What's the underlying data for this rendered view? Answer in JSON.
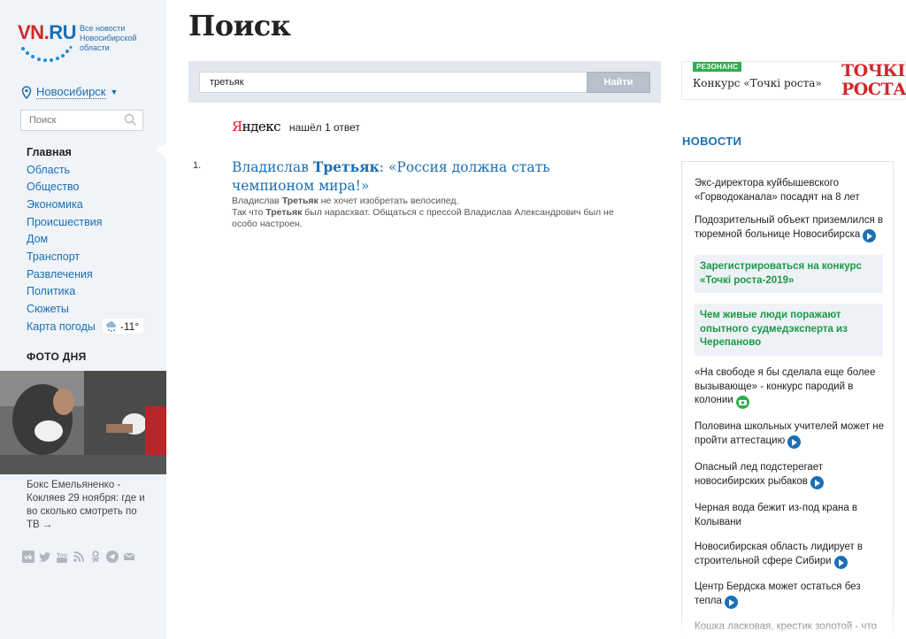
{
  "logo": {
    "brand_vn": "VN",
    "brand_dot": ".",
    "brand_ru": "RU",
    "tagline": "Все новости Новосибирской области"
  },
  "city": {
    "label": "Новосибирск"
  },
  "sidebar_search": {
    "placeholder": "Поиск"
  },
  "nav": {
    "items": [
      {
        "label": "Главная",
        "active": true
      },
      {
        "label": "Область"
      },
      {
        "label": "Общество"
      },
      {
        "label": "Экономика"
      },
      {
        "label": "Происшествия"
      },
      {
        "label": "Дом"
      },
      {
        "label": "Транспорт"
      },
      {
        "label": "Развлечения"
      },
      {
        "label": "Политика"
      },
      {
        "label": "Сюжеты"
      },
      {
        "label": "Карта погоды"
      }
    ],
    "weather_temp": "-11°"
  },
  "photo_of_day": {
    "title": "ФОТО ДНЯ",
    "caption": "Бокс Емельяненко - Кокляев 29 ноября: где и во сколько смотреть по ТВ",
    "caption_arrow": "→"
  },
  "socials": [
    "vk-icon",
    "twitter-icon",
    "youtube-icon",
    "rss-icon",
    "odnoklassniki-icon",
    "telegram-icon",
    "mail-icon"
  ],
  "page": {
    "title": "Поиск"
  },
  "search": {
    "value": "третьяк",
    "button_label": "Найти"
  },
  "results_header": {
    "yandex_y": "Я",
    "yandex_rest": "ндекс",
    "found_text": "нашёл 1 ответ"
  },
  "results": [
    {
      "num": "1.",
      "title_pre": "Владислав ",
      "title_hit": "Третьяк",
      "title_post": ": «Россия должна стать чемпионом мира!»",
      "snippet_1_pre": "Владислав ",
      "snippet_1_hit": "Третьяк",
      "snippet_1_post": " не хочет изобретать велосипед.",
      "snippet_2_pre": "Так что ",
      "snippet_2_hit": "Третьяк",
      "snippet_2_post": " был нарасхват. Общаться с прессой Владислав Александрович был не особо настроен."
    }
  ],
  "ad": {
    "badge": "РЕЗОНАНС",
    "text": "Конкурс «Точкі роста»",
    "brand_1": "ТОЧКІ",
    "brand_2": "РОСТА"
  },
  "news": {
    "title": "НОВОСТИ",
    "items": [
      {
        "text": "Экс-директора куйбышевского «Горводоканала» посадят на 8 лет"
      },
      {
        "text": "Подозрительный объект приземлился в тюремной больнице Новосибирска",
        "icon": "video"
      },
      {
        "text": "Зарегистрироваться на конкурс «Точкі роста-2019»",
        "promo": true
      },
      {
        "text": "Чем живые люди поражают опытного судмедэксперта из Черепаново",
        "promo": true
      },
      {
        "text": "«На свободе я бы сделала еще более вызывающе» - конкурс пародий в колонии",
        "icon": "photo"
      },
      {
        "text": "Половина школьных учителей может не пройти аттестацию",
        "icon": "video"
      },
      {
        "text": "Опасный лед подстерегает новосибирских рыбаков",
        "icon": "video"
      },
      {
        "text": "Черная вода бежит из-под крана в Колывани"
      },
      {
        "text": "Новосибирская область лидирует в строительной сфере Сибири",
        "icon": "video"
      },
      {
        "text": "Центр Бердска может остаться без тепла",
        "icon": "video"
      },
      {
        "text": "Кошка ласковая, крестик золотой - что"
      }
    ]
  },
  "colors": {
    "link": "#1a6fb5",
    "brand_red": "#d3262a",
    "promo_green": "#1a9948",
    "sidebar_bg": "#f0f3f7"
  }
}
